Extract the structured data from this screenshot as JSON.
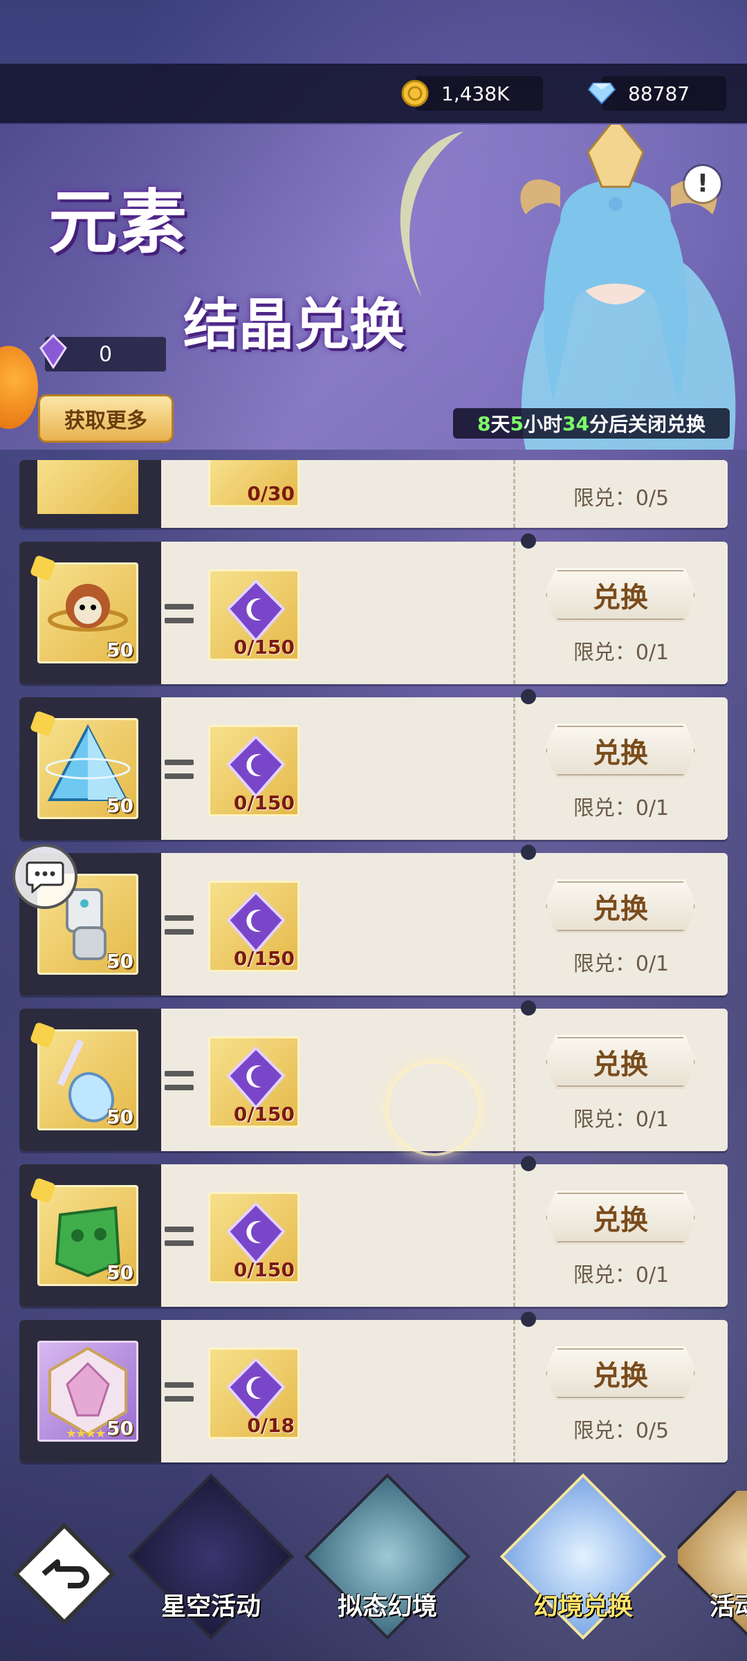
{
  "currency": {
    "coins": "1,438K",
    "gems": "88787"
  },
  "banner": {
    "title_line1": "元素",
    "title_line2": "结晶兑换",
    "crystal_count": "0",
    "get_more_label": "获取更多",
    "timer": {
      "days": "8",
      "day_unit": "天",
      "hours": "5",
      "hour_unit": "小时",
      "minutes": "34",
      "minute_unit": "分",
      "suffix": "后关闭兑换"
    }
  },
  "exchange_rows": [
    {
      "item": "crystal-orb",
      "cost": "0/30",
      "button": "",
      "limit": "限兑：0/5"
    },
    {
      "item": "robot-pet",
      "qty": "50",
      "cost": "0/150",
      "button": "兑换",
      "limit": "限兑：0/1"
    },
    {
      "item": "ice-pyramid",
      "qty": "50",
      "cost": "0/150",
      "button": "兑换",
      "limit": "限兑：0/1"
    },
    {
      "item": "mech-gauntlet",
      "qty": "50",
      "cost": "0/150",
      "button": "兑换",
      "limit": "限兑：0/1"
    },
    {
      "item": "crystal-violin",
      "qty": "50",
      "cost": "0/150",
      "button": "兑换",
      "limit": "限兑：0/1"
    },
    {
      "item": "jade-mask",
      "qty": "50",
      "cost": "0/150",
      "button": "兑换",
      "limit": "限兑：0/1"
    },
    {
      "item": "pink-gem",
      "qty": "50",
      "cost": "0/18",
      "button": "兑换",
      "limit": "限兑：0/5",
      "stars": "★★★★"
    }
  ],
  "nav": {
    "tabs": [
      {
        "label": "星空活动"
      },
      {
        "label": "拟态幻境"
      },
      {
        "label": "幻境兑换"
      },
      {
        "label": "活动"
      }
    ],
    "active_index": 2
  },
  "colors": {
    "accent_gold": "#e5b94a",
    "timer_green": "#7dff6b",
    "button_text": "#7a4c1d"
  }
}
